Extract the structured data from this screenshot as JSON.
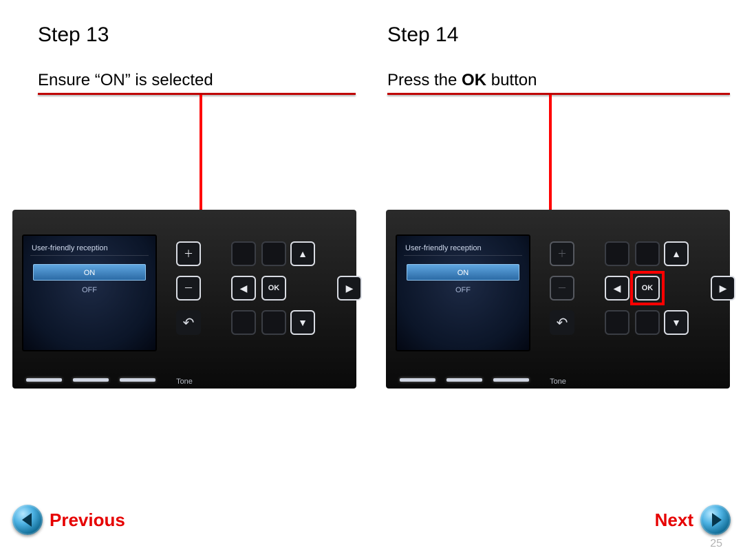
{
  "left": {
    "heading": "Step 13",
    "instruction": "Ensure “ON” is selected",
    "lcd_title": "User-friendly reception",
    "option_on": "ON",
    "option_off": "OFF",
    "ok_label": "OK",
    "tone_label": "Tone"
  },
  "right": {
    "heading": "Step 14",
    "instruction_pre": "Press the ",
    "instruction_bold": "OK",
    "instruction_post": " button",
    "lcd_title": "User-friendly reception",
    "option_on": "ON",
    "option_off": "OFF",
    "ok_label": "OK",
    "tone_label": "Tone"
  },
  "nav": {
    "previous": "Previous",
    "next": "Next"
  },
  "page_number": "25"
}
